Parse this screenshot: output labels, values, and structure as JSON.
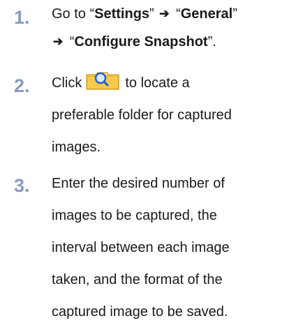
{
  "steps": [
    {
      "number": "1.",
      "prefix": "Go to “",
      "menu1": "Settings",
      "sep1": "” ",
      "arrow": "➔",
      "open2": " “",
      "menu2": "General",
      "close2": "”",
      "open3": " “",
      "menu3": "Configure Snapshot",
      "suffix": "”."
    },
    {
      "number": "2.",
      "before": "Click",
      "after_line1": "to locate a",
      "line2": "preferable folder for captured",
      "line3": "images.",
      "button_icon": "folder-search-icon"
    },
    {
      "number": "3.",
      "lines": [
        "Enter the desired number of",
        "images to be captured, the",
        "interval between each image",
        "taken, and the format of the",
        "captured image to be saved."
      ]
    }
  ],
  "colors": {
    "step_number": "#8a9bbf",
    "text": "#1a1a1a",
    "folder_fill": "#f5c542",
    "folder_edge": "#c48a0c",
    "magnifier": "#2a62c9"
  }
}
